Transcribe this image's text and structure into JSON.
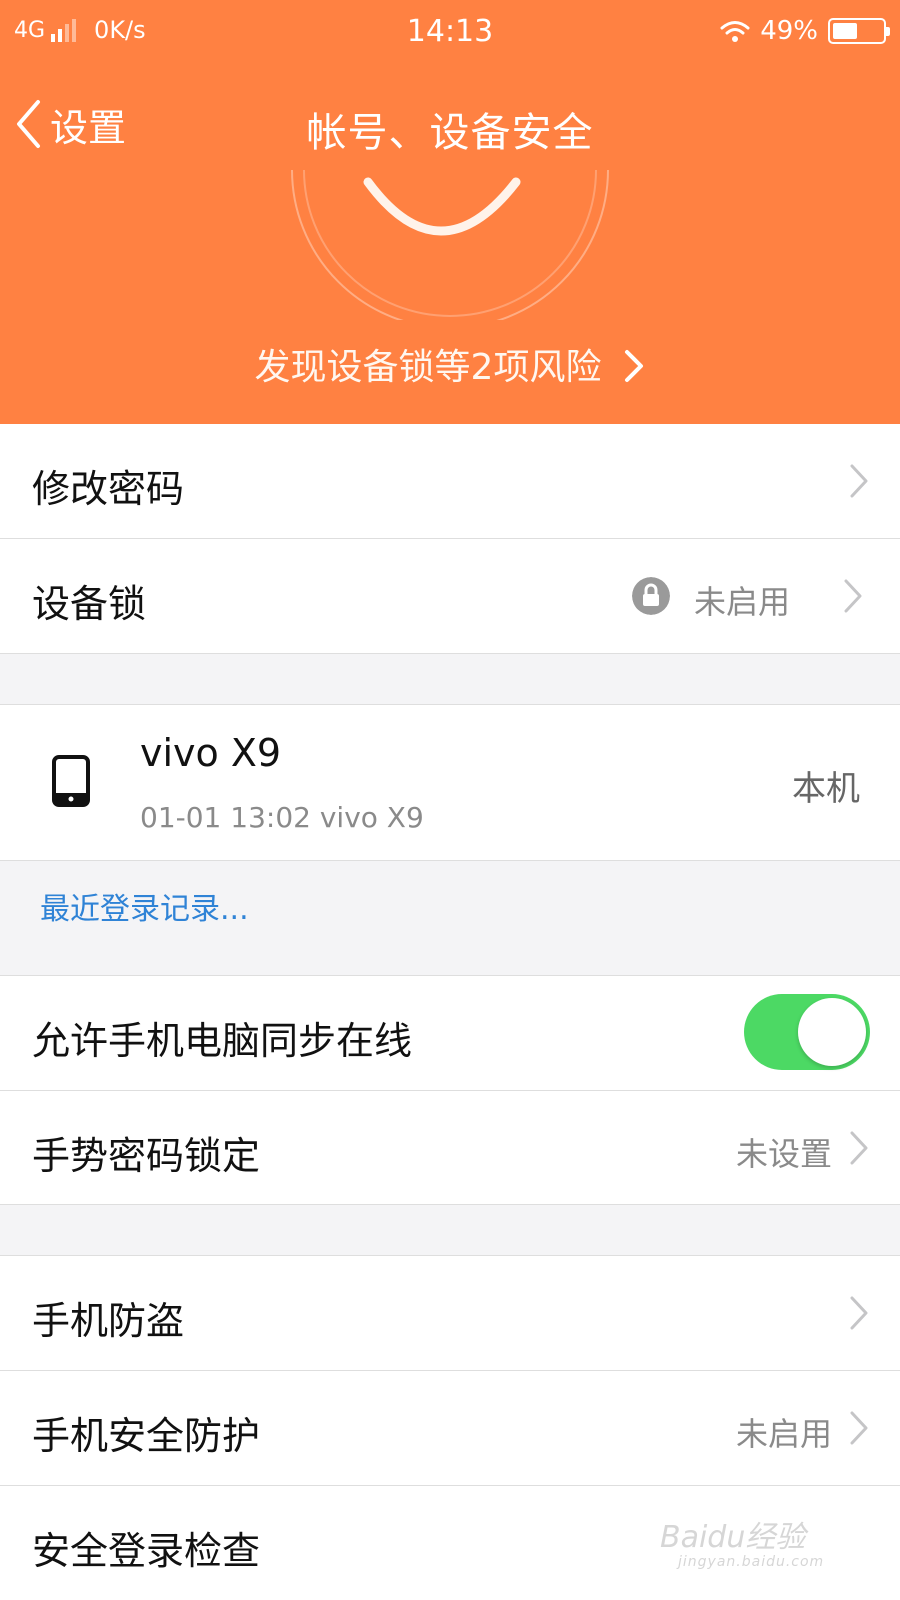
{
  "status_bar": {
    "network": "4G",
    "speed": "0K/s",
    "time": "14:13",
    "battery": "49%"
  },
  "nav": {
    "back_label": "设置",
    "title": "帐号、设备安全"
  },
  "risk": {
    "text": "发现设备锁等2项风险"
  },
  "items": {
    "change_password": {
      "label": "修改密码"
    },
    "device_lock": {
      "label": "设备锁",
      "value": "未启用"
    },
    "sync_online": {
      "label": "允许手机电脑同步在线",
      "enabled": true
    },
    "gesture_lock": {
      "label": "手势密码锁定",
      "value": "未设置"
    },
    "anti_theft": {
      "label": "手机防盗"
    },
    "security_protect": {
      "label": "手机安全防护",
      "value": "未启用"
    },
    "login_check": {
      "label": "安全登录检查"
    }
  },
  "device": {
    "name": "vivo X9",
    "detail": "01-01 13:02 vivo X9",
    "tag": "本机"
  },
  "recent_login": {
    "label": "最近登录记录..."
  },
  "watermark": {
    "main": "Baidu经验",
    "sub": "jingyan.baidu.com"
  },
  "colors": {
    "header_bg": "#ff8142",
    "toggle_on": "#4cd964",
    "link_blue": "#2f83d6"
  }
}
